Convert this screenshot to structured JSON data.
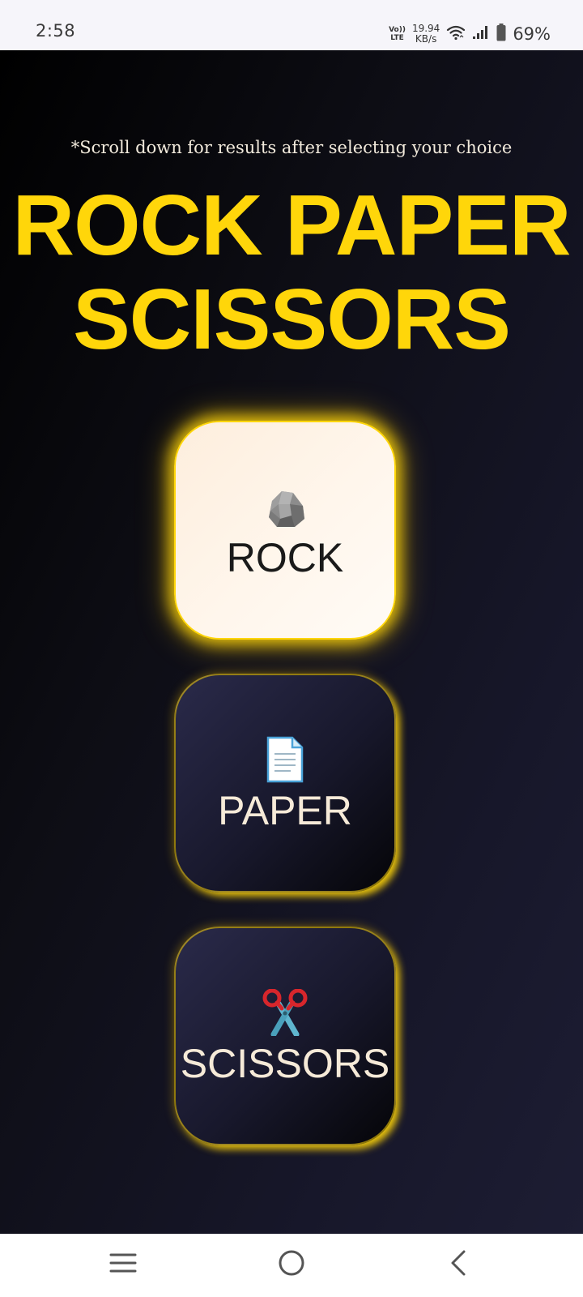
{
  "status_bar": {
    "time": "2:58",
    "volte_top": "Vo))",
    "volte_bottom": "LTE",
    "speed_value": "19.94",
    "speed_unit": "KB/s",
    "battery_percent": "69%",
    "icons": [
      "volte-icon",
      "wifi-icon",
      "signal-icon",
      "battery-icon"
    ]
  },
  "game": {
    "hint": "*Scroll down for results after selecting your choice",
    "title_line1": "ROCK PAPER",
    "title_line2": "SCISSORS",
    "accent_color": "#ffd60a",
    "choices": [
      {
        "label": "ROCK",
        "icon": "rock-icon",
        "selected": true
      },
      {
        "label": "PAPER",
        "icon": "paper-icon",
        "selected": false
      },
      {
        "label": "SCISSORS",
        "icon": "scissors-icon",
        "selected": false
      }
    ]
  },
  "nav_bar": {
    "icons": [
      "menu-icon",
      "home-icon",
      "back-icon"
    ]
  }
}
